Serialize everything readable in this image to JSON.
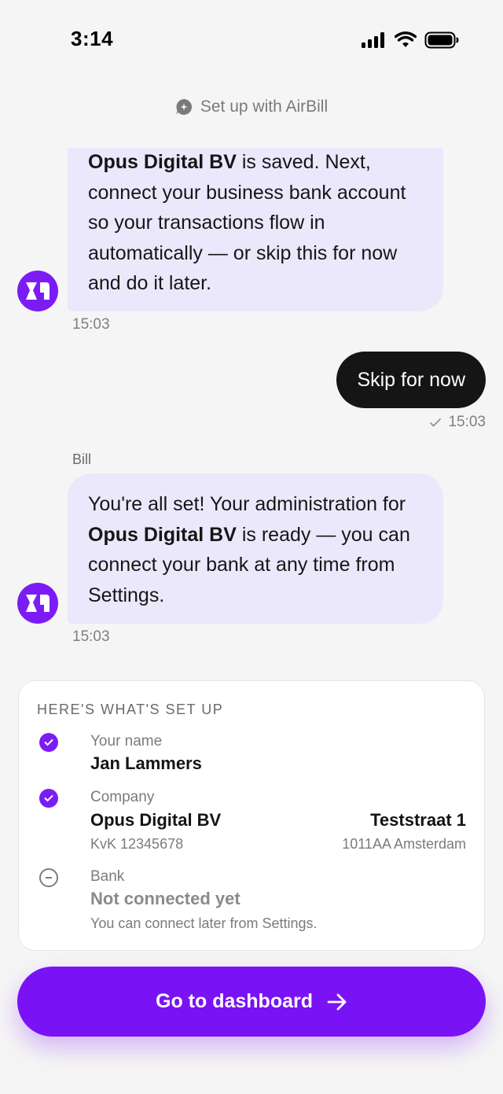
{
  "status_bar": {
    "time": "3:14"
  },
  "header": {
    "title": "Set up with AirBill"
  },
  "chat": {
    "message1": {
      "company": "Opus Digital BV",
      "text": " is saved. Next, connect your business bank account so your transactions flow in automatically — or skip this for now and do it later.",
      "time": "15:03"
    },
    "reply": {
      "text": "Skip for now",
      "time": "15:03"
    },
    "sender_name": "Bill",
    "message2": {
      "text_before": "You're all set! Your administration for ",
      "company": "Opus Digital BV",
      "text_after": " is ready — you can connect your bank at any time from Settings.",
      "time": "15:03"
    }
  },
  "summary": {
    "title": "HERE'S WHAT'S SET UP",
    "name": {
      "label": "Your name",
      "value": "Jan Lammers"
    },
    "company": {
      "label": "Company",
      "value": "Opus Digital BV",
      "kvk": "KvK 12345678",
      "street": "Teststraat 1",
      "city": "1011AA Amsterdam"
    },
    "bank": {
      "label": "Bank",
      "value": "Not connected yet",
      "note": "You can connect later from Settings."
    }
  },
  "cta": {
    "label": "Go to dashboard"
  },
  "colors": {
    "accent": "#7a12f6",
    "bubble_in": "#ebe8fc",
    "bubble_out": "#151515"
  }
}
